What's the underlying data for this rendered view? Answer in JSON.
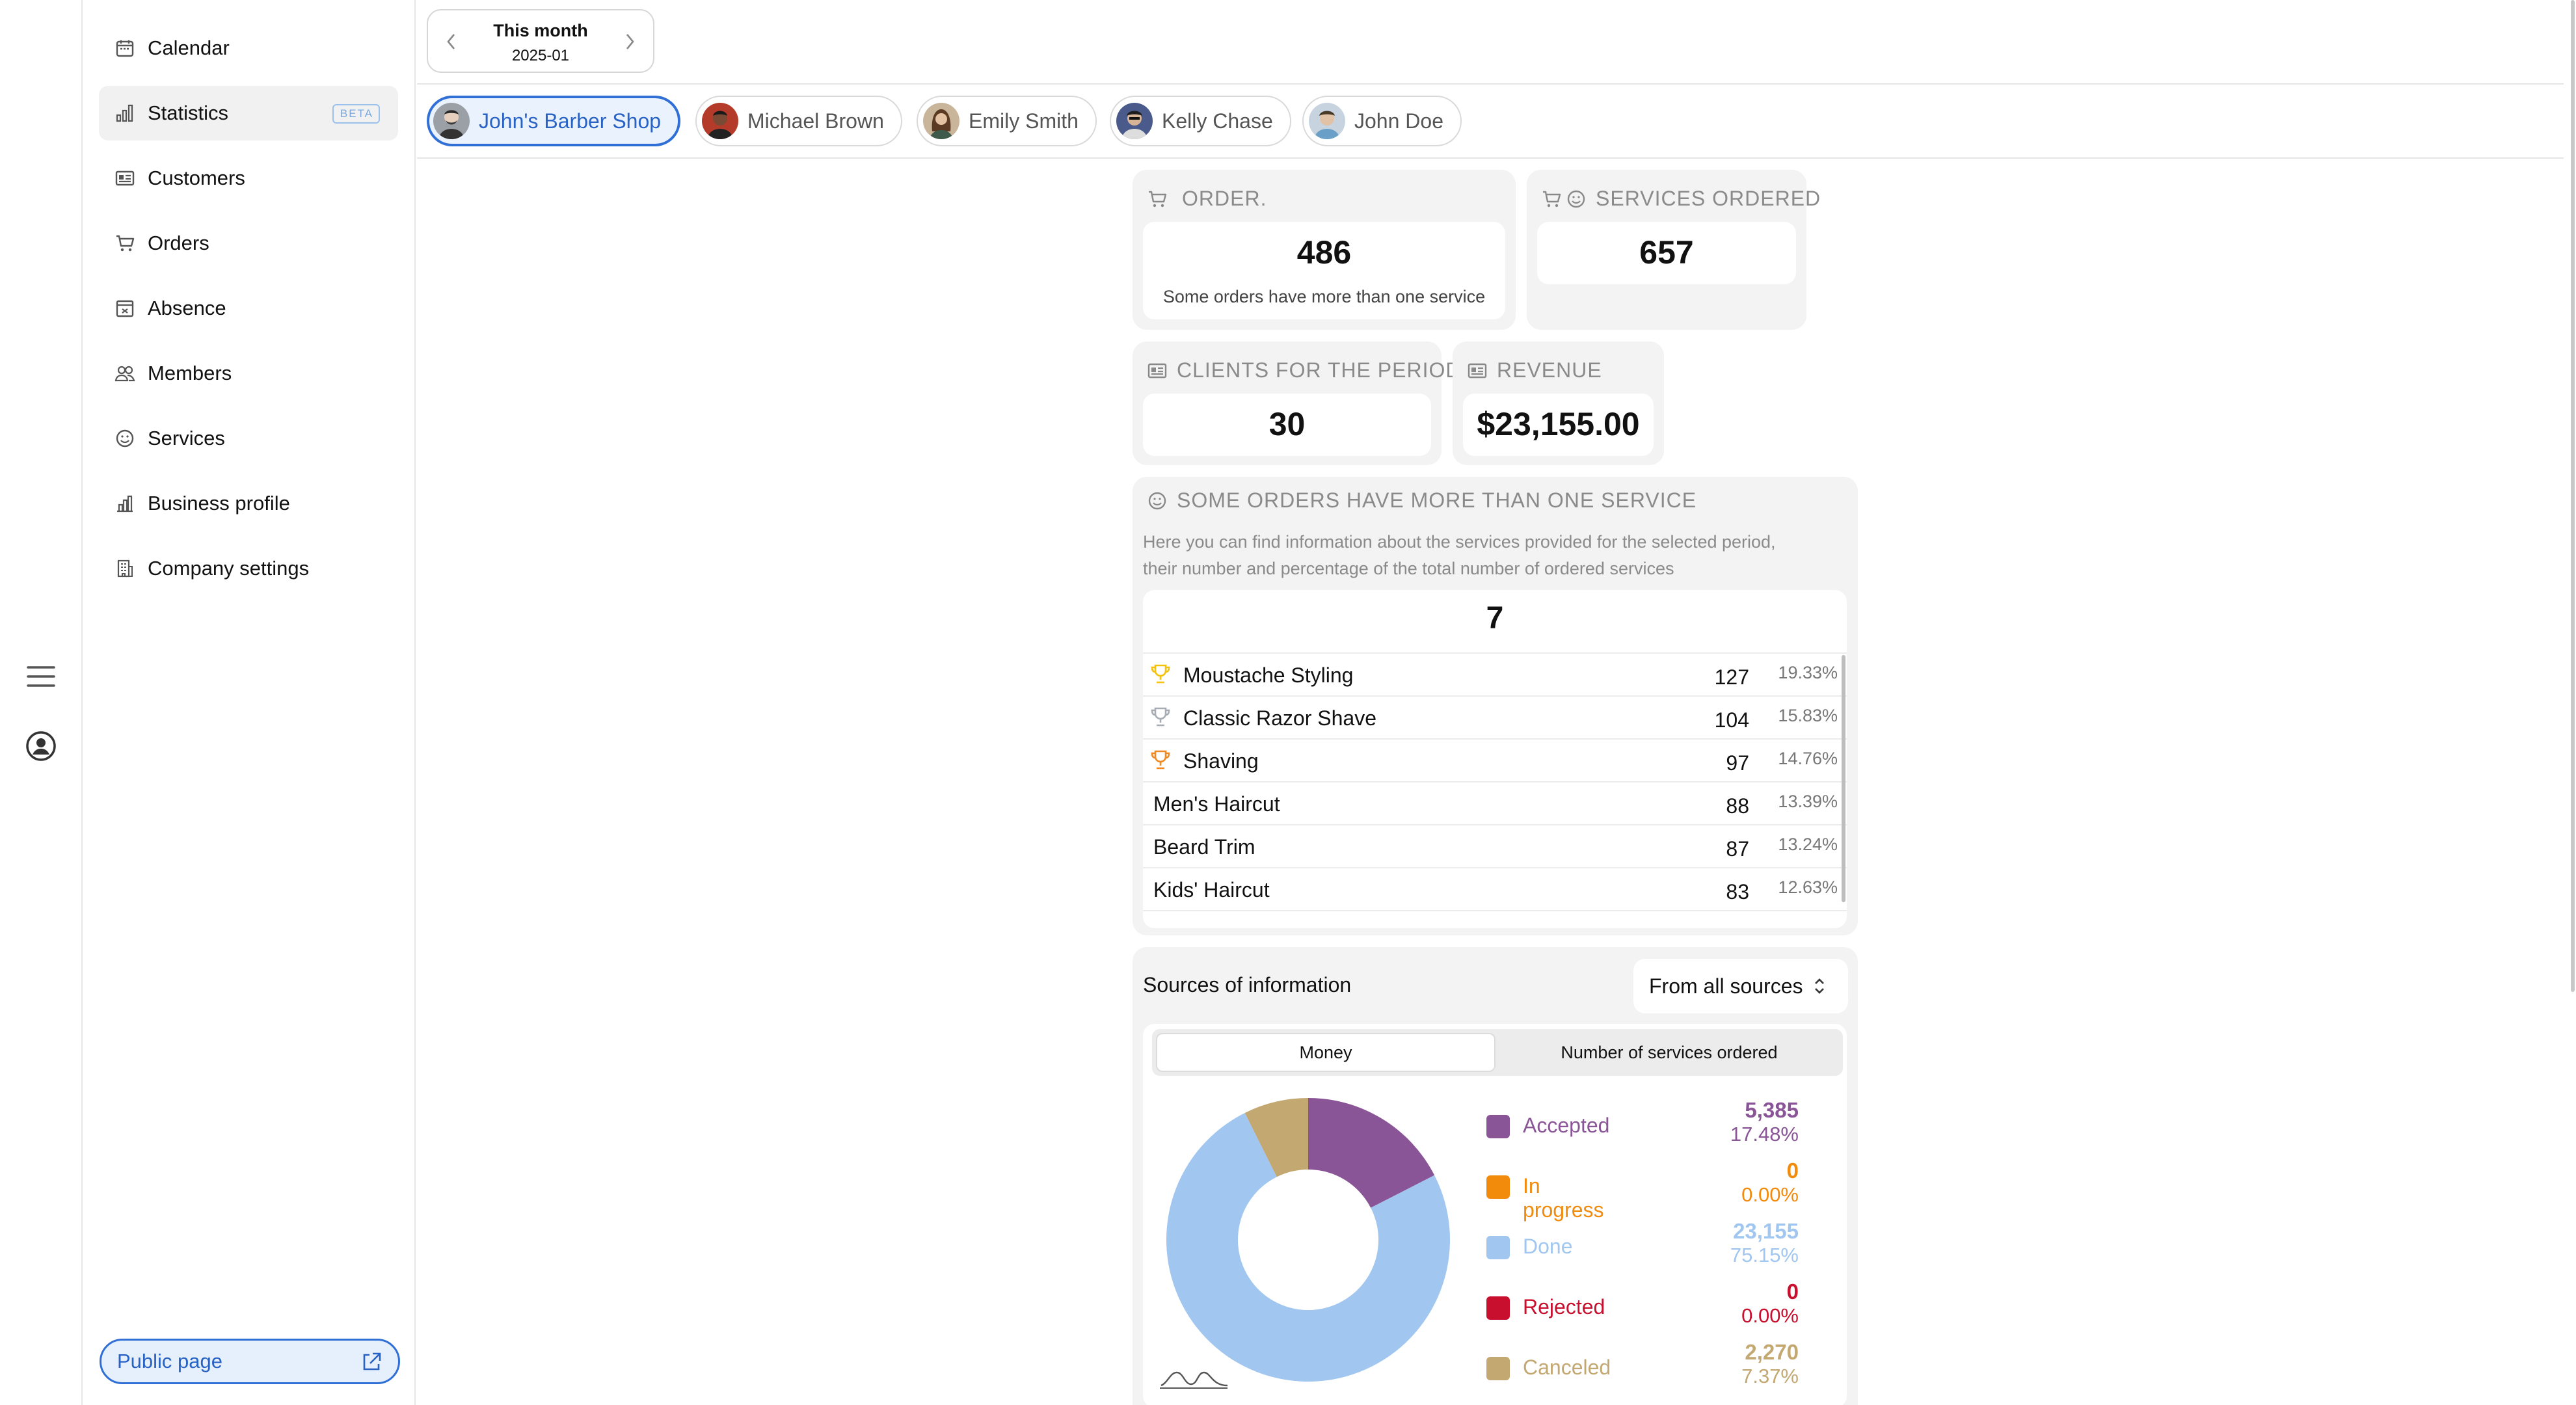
{
  "sidebar": {
    "items": [
      {
        "label": "Calendar",
        "icon": "calendar-icon"
      },
      {
        "label": "Statistics",
        "icon": "bar-chart-icon",
        "badge": "BETA"
      },
      {
        "label": "Customers",
        "icon": "id-card-icon"
      },
      {
        "label": "Orders",
        "icon": "cart-icon"
      },
      {
        "label": "Absence",
        "icon": "absence-calendar-icon"
      },
      {
        "label": "Members",
        "icon": "people-icon"
      },
      {
        "label": "Services",
        "icon": "smile-icon"
      },
      {
        "label": "Business profile",
        "icon": "chart-building-icon"
      },
      {
        "label": "Company settings",
        "icon": "building-icon"
      }
    ],
    "public_page": "Public page"
  },
  "period": {
    "title": "This month",
    "value": "2025-01"
  },
  "members": [
    {
      "name": "John's Barber Shop",
      "active": true
    },
    {
      "name": "Michael Brown",
      "active": false
    },
    {
      "name": "Emily Smith",
      "active": false
    },
    {
      "name": "Kelly Chase",
      "active": false
    },
    {
      "name": "John Doe",
      "active": false
    }
  ],
  "stats": {
    "orders": {
      "label": "ORDER.",
      "value": "486",
      "note": "Some orders have more than one service"
    },
    "services_ordered": {
      "label": "SERVICES ORDERED",
      "value": "657"
    },
    "clients": {
      "label": "CLIENTS FOR THE PERIOD",
      "value": "30"
    },
    "revenue": {
      "label": "REVENUE",
      "value": "$23,155.00"
    }
  },
  "services_panel": {
    "title": "SOME ORDERS HAVE MORE THAN ONE SERVICE",
    "description_line1": "Here you can find information about the services provided for the selected period,",
    "description_line2": "their number and percentage of the total number of ordered services",
    "total": "7",
    "rows": [
      {
        "name": "Moustache Styling",
        "count": "127",
        "percent": "19.33%",
        "trophy": "gold"
      },
      {
        "name": "Classic Razor Shave",
        "count": "104",
        "percent": "15.83%",
        "trophy": "silver"
      },
      {
        "name": "Shaving",
        "count": "97",
        "percent": "14.76%",
        "trophy": "bronze"
      },
      {
        "name": "Men's Haircut",
        "count": "88",
        "percent": "13.39%",
        "trophy": ""
      },
      {
        "name": "Beard Trim",
        "count": "87",
        "percent": "13.24%",
        "trophy": ""
      },
      {
        "name": "Kids' Haircut",
        "count": "83",
        "percent": "12.63%",
        "trophy": ""
      }
    ]
  },
  "sources": {
    "title": "Sources of information",
    "select_value": "From all sources",
    "tabs": [
      "Money",
      "Number of services ordered"
    ],
    "active_tab": 0,
    "legend": [
      {
        "label": "Accepted",
        "value": "5,385",
        "percent": "17.48%",
        "color": "#8a5597"
      },
      {
        "label": "In progress",
        "value": "0",
        "percent": "0.00%",
        "color": "#f28a0c"
      },
      {
        "label": "Done",
        "value": "23,155",
        "percent": "75.15%",
        "color": "#a1c7f0"
      },
      {
        "label": "Rejected",
        "value": "0",
        "percent": "0.00%",
        "color": "#c8102e"
      },
      {
        "label": "Canceled",
        "value": "2,270",
        "percent": "7.37%",
        "color": "#c3a872"
      }
    ]
  },
  "chart_data": {
    "type": "pie",
    "categories": [
      "Accepted",
      "In progress",
      "Done",
      "Rejected",
      "Canceled"
    ],
    "values": [
      5385,
      0,
      23155,
      0,
      2270
    ],
    "colors": [
      "#8a5597",
      "#f28a0c",
      "#a1c7f0",
      "#c8102e",
      "#c3a872"
    ],
    "donut": true
  }
}
